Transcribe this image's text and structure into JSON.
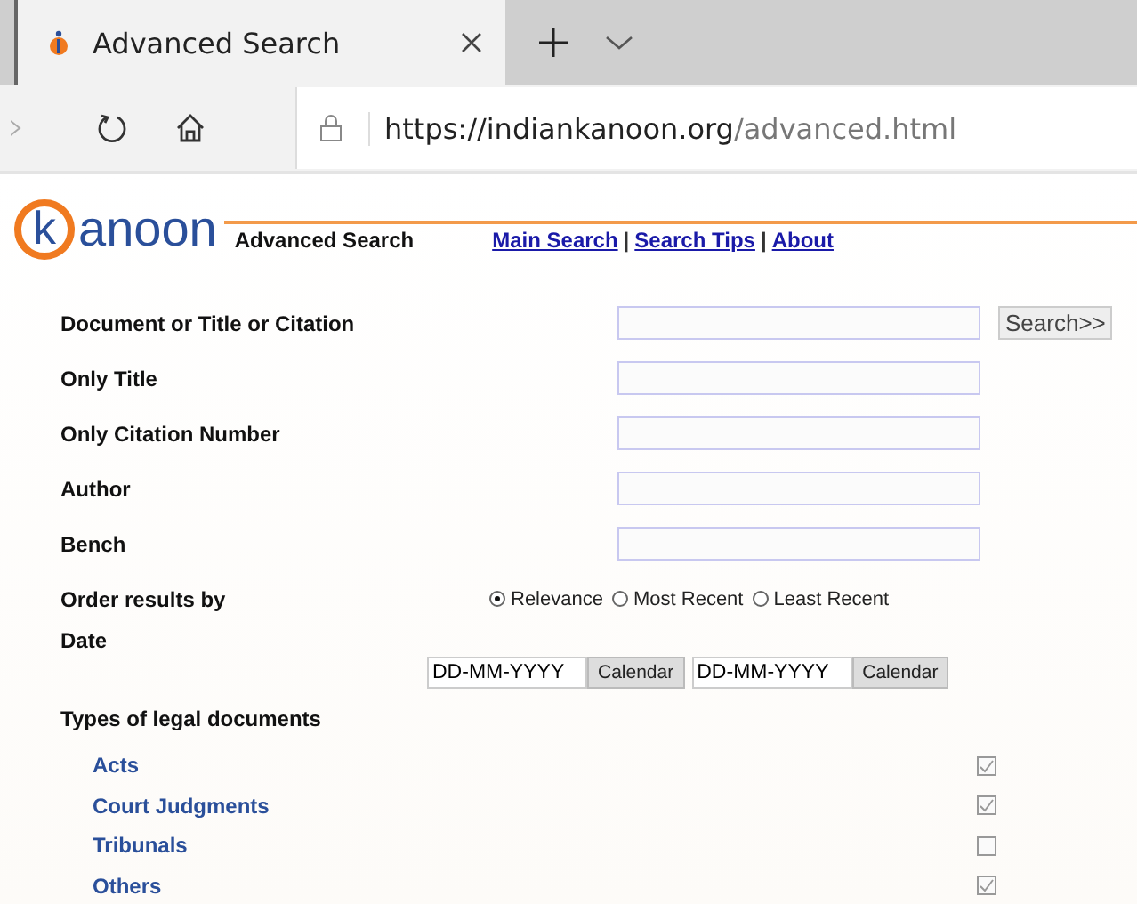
{
  "browser": {
    "tab_title": "Advanced Search",
    "url_host": "https://indiankanoon.org",
    "url_path": "/advanced.html"
  },
  "header": {
    "logo_mark": "k",
    "logo_text": "anoon",
    "title": "Advanced Search",
    "links": [
      "Main Search",
      "Search Tips",
      "About"
    ],
    "separators": [
      "|",
      "|"
    ]
  },
  "fields": [
    {
      "label": "Document or Title or Citation",
      "button": "Search>>"
    },
    {
      "label": "Only Title"
    },
    {
      "label": "Only Citation Number"
    },
    {
      "label": "Author"
    },
    {
      "label": "Bench"
    }
  ],
  "order": {
    "label": "Order results by",
    "options": [
      {
        "label": "Relevance",
        "selected": true
      },
      {
        "label": "Most Recent",
        "selected": false
      },
      {
        "label": "Least Recent",
        "selected": false
      }
    ]
  },
  "date": {
    "label": "Date",
    "inputs": [
      {
        "value": "DD-MM-YYYY",
        "button": "Calendar"
      },
      {
        "value": "DD-MM-YYYY",
        "button": "Calendar"
      }
    ]
  },
  "types": {
    "label": "Types of legal documents",
    "items": [
      {
        "label": "Acts",
        "checked": true
      },
      {
        "label": "Court Judgments",
        "checked": true
      },
      {
        "label": "Tribunals",
        "checked": false
      },
      {
        "label": "Others",
        "checked": true
      }
    ]
  }
}
